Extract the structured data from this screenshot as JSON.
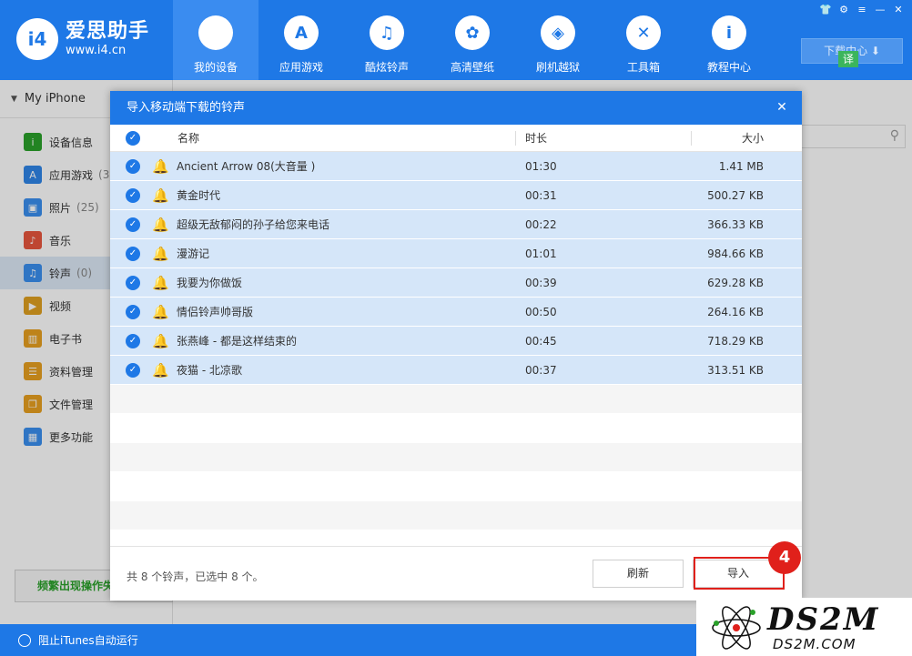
{
  "app": {
    "name": "爱思助手",
    "url": "www.i4.cn"
  },
  "nav": [
    {
      "label": "我的设备",
      "icon": "apple-icon",
      "glyph": "",
      "active": true
    },
    {
      "label": "应用游戏",
      "icon": "app-store-icon",
      "glyph": "A"
    },
    {
      "label": "酷炫铃声",
      "icon": "bell-icon",
      "glyph": "♫"
    },
    {
      "label": "高清壁纸",
      "icon": "flower-icon",
      "glyph": "✿"
    },
    {
      "label": "刷机越狱",
      "icon": "box-icon",
      "glyph": "◈"
    },
    {
      "label": "工具箱",
      "icon": "tools-icon",
      "glyph": "✕"
    },
    {
      "label": "教程中心",
      "icon": "info-icon",
      "glyph": "i"
    }
  ],
  "window_controls": [
    "👕",
    "⚙",
    "≡",
    "—",
    "✕"
  ],
  "download": {
    "label": "下载中心 ⬇",
    "badge": "译"
  },
  "device": {
    "name": "My iPhone"
  },
  "sidebar": {
    "items": [
      {
        "label": "设备信息",
        "icon": "info-icon",
        "color": "#2aa12a",
        "glyph": "i",
        "count": ""
      },
      {
        "label": "应用游戏",
        "icon": "app-store-icon",
        "color": "#2f86e8",
        "glyph": "A",
        "count": "(3"
      },
      {
        "label": "照片",
        "icon": "photo-icon",
        "color": "#3a8ff0",
        "glyph": "▣",
        "count": "(25)"
      },
      {
        "label": "音乐",
        "icon": "music-icon",
        "color": "#e8563e",
        "glyph": "♪",
        "count": ""
      },
      {
        "label": "铃声",
        "icon": "bell-icon",
        "color": "#3a8ff0",
        "glyph": "♫",
        "count": "(0)",
        "active": true
      },
      {
        "label": "视频",
        "icon": "video-icon",
        "color": "#e0a020",
        "glyph": "▶",
        "count": ""
      },
      {
        "label": "电子书",
        "icon": "book-icon",
        "color": "#e8a020",
        "glyph": "▥",
        "count": ""
      },
      {
        "label": "资料管理",
        "icon": "contacts-icon",
        "color": "#e8a020",
        "glyph": "☰",
        "count": ""
      },
      {
        "label": "文件管理",
        "icon": "file-icon",
        "color": "#e8a020",
        "glyph": "❐",
        "count": ""
      },
      {
        "label": "更多功能",
        "icon": "grid-icon",
        "color": "#3a8ff0",
        "glyph": "▦",
        "count": ""
      }
    ],
    "warn_label": "频繁出现操作失"
  },
  "bottombar": {
    "itunes_label": "阻止iTunes自动运行"
  },
  "dialog": {
    "title": "导入移动端下载的铃声",
    "close": "✕",
    "columns": {
      "name": "名称",
      "duration": "时长",
      "size": "大小"
    },
    "rows": [
      {
        "name": "Ancient Arrow 08(大音量 )",
        "duration": "01:30",
        "size": "1.41 MB"
      },
      {
        "name": "黄金时代",
        "duration": "00:31",
        "size": "500.27 KB"
      },
      {
        "name": "超级无敌郁闷的孙子给您来电话",
        "duration": "00:22",
        "size": "366.33 KB"
      },
      {
        "name": "漫游记",
        "duration": "01:01",
        "size": "984.66 KB"
      },
      {
        "name": "我要为你做饭",
        "duration": "00:39",
        "size": "629.28 KB"
      },
      {
        "name": "情侣铃声帅哥版",
        "duration": "00:50",
        "size": "264.16 KB"
      },
      {
        "name": "张燕峰 - 都是这样结束的",
        "duration": "00:45",
        "size": "718.29 KB"
      },
      {
        "name": "夜猫 - 北凉歌",
        "duration": "00:37",
        "size": "313.51 KB"
      }
    ],
    "footer_text": "共 8 个铃声，已选中 8 个。",
    "refresh_label": "刷新",
    "import_label": "导入"
  },
  "step_number": "4",
  "watermark": {
    "big": "DS2M",
    "small": "DS2M.COM"
  }
}
